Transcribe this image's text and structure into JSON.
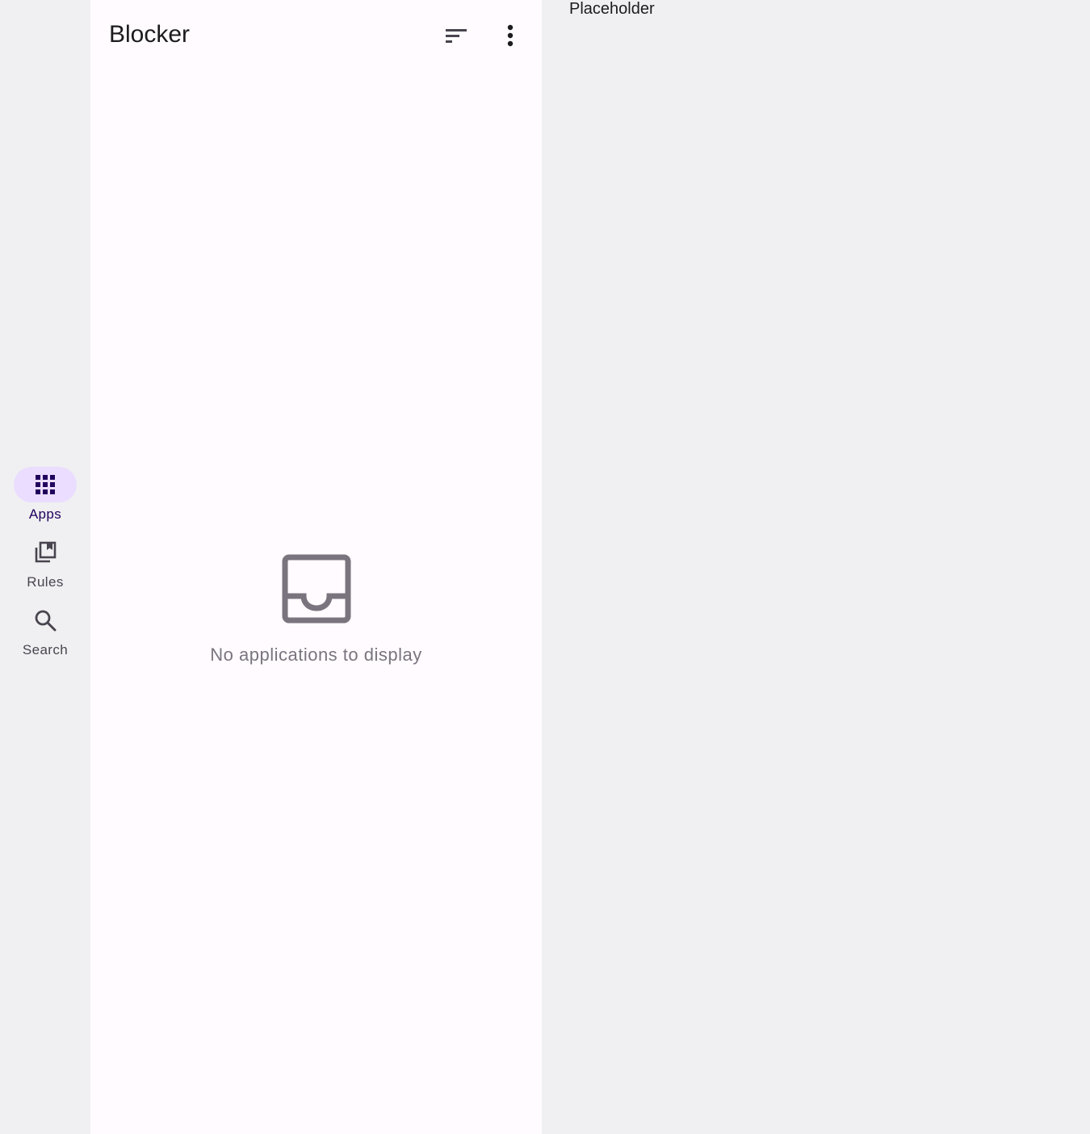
{
  "nav": {
    "items": [
      {
        "label": "Apps",
        "icon": "apps-grid-icon",
        "active": true
      },
      {
        "label": "Rules",
        "icon": "library-bookmark-icon",
        "active": false
      },
      {
        "label": "Search",
        "icon": "search-icon",
        "active": false
      }
    ]
  },
  "list": {
    "title": "Blocker",
    "sort_icon": "sort-icon",
    "more_icon": "more-vert-icon",
    "empty_icon": "inbox-icon",
    "empty_message": "No applications to display"
  },
  "detail": {
    "placeholder": "Placeholder"
  },
  "colors": {
    "background": "#f0f0f2",
    "surface": "#fffbfe",
    "active_indicator": "#eaddff",
    "active_label": "#21005d",
    "empty_icon": "#79747e"
  }
}
